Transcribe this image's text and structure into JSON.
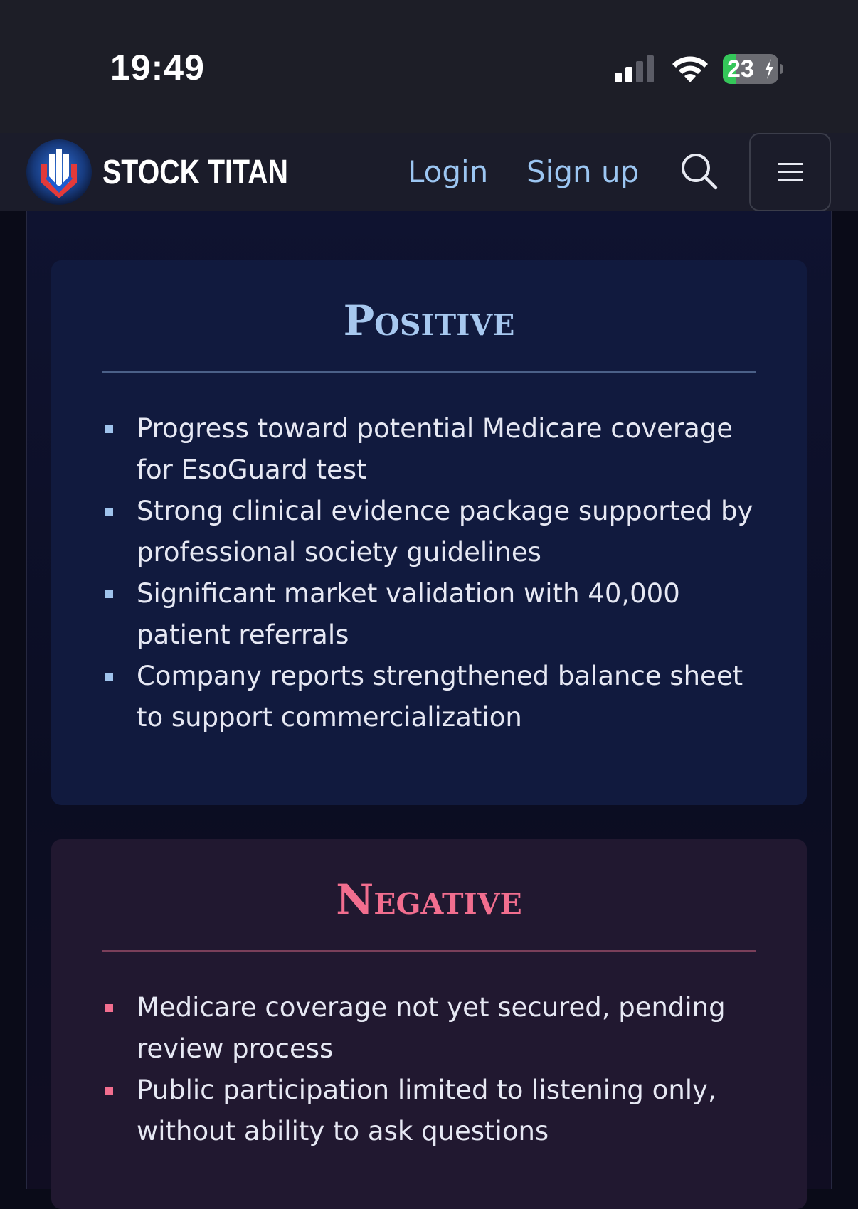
{
  "status_bar": {
    "time": "19:49",
    "battery_level": "23",
    "battery_fraction": 0.23,
    "signal_icon": "cellular-signal-icon",
    "wifi_icon": "wifi-icon"
  },
  "header": {
    "brand": "STOCK TITAN",
    "login_label": "Login",
    "signup_label": "Sign up",
    "search_icon": "search-icon",
    "menu_icon": "hamburger-menu-icon"
  },
  "positive": {
    "title": "Positive",
    "accent": "#a7c8ef",
    "items": [
      "Progress toward potential Medicare coverage for EsoGuard test",
      "Strong clinical evidence package supported by professional society guidelines",
      "Significant market validation with 40,000 patient referrals",
      "Company reports strengthened balance sheet to support commercialization"
    ]
  },
  "negative": {
    "title": "Negative",
    "accent": "#f26e8f",
    "items": [
      "Medicare coverage not yet secured, pending review process",
      "Public participation limited to listening only, without ability to ask questions"
    ]
  }
}
